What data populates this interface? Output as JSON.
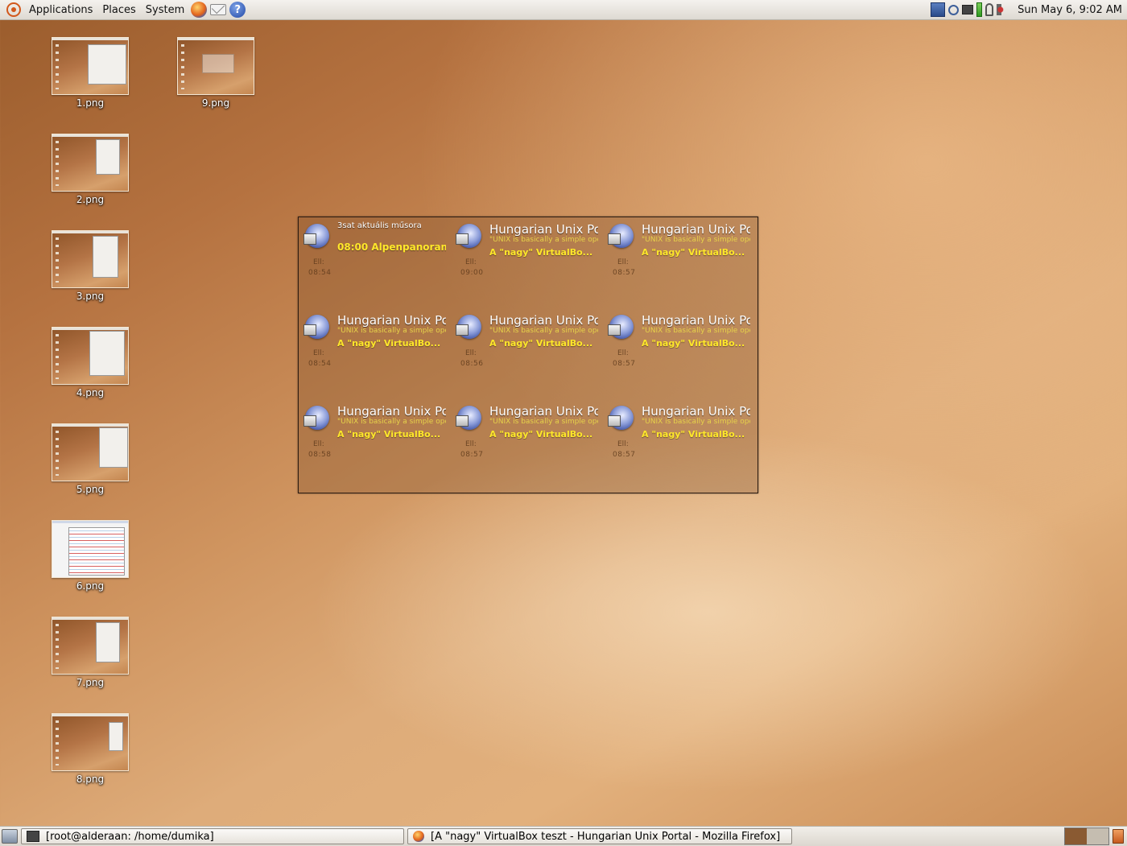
{
  "top_panel": {
    "menus": [
      "Applications",
      "Places",
      "System"
    ],
    "clock": "Sun May  6,  9:02 AM"
  },
  "desktop_icons": [
    {
      "label": "1.png"
    },
    {
      "label": "9.png"
    },
    {
      "label": "2.png"
    },
    {
      "label": "3.png"
    },
    {
      "label": "4.png"
    },
    {
      "label": "5.png"
    },
    {
      "label": "6.png"
    },
    {
      "label": "7.png"
    },
    {
      "label": "8.png"
    }
  ],
  "feed": {
    "ell_label": "Ell:",
    "items": [
      {
        "title": "3sat aktuális műsora",
        "subtitle": "",
        "headline": "08:00 Alpenpanoram...",
        "time": "08:54"
      },
      {
        "title": "Hungarian Unix Portal",
        "subtitle": "\"UNIX is basically a simple operating system\"",
        "headline": "A \"nagy\" VirtualBo...",
        "time": "09:00"
      },
      {
        "title": "Hungarian Unix Portal",
        "subtitle": "\"UNIX is basically a simple operating system\"",
        "headline": "A \"nagy\" VirtualBo...",
        "time": "08:57"
      },
      {
        "title": "Hungarian Unix Portal",
        "subtitle": "\"UNIX is basically a simple operating system\"",
        "headline": "A \"nagy\" VirtualBo...",
        "time": "08:54"
      },
      {
        "title": "Hungarian Unix Portal",
        "subtitle": "\"UNIX is basically a simple operating system\"",
        "headline": "A \"nagy\" VirtualBo...",
        "time": "08:56"
      },
      {
        "title": "Hungarian Unix Portal",
        "subtitle": "\"UNIX is basically a simple operating system\"",
        "headline": "A \"nagy\" VirtualBo...",
        "time": "08:57"
      },
      {
        "title": "Hungarian Unix Portal",
        "subtitle": "\"UNIX is basically a simple operating system\"",
        "headline": "A \"nagy\" VirtualBo...",
        "time": "08:58"
      },
      {
        "title": "Hungarian Unix Portal",
        "subtitle": "\"UNIX is basically a simple operating system\"",
        "headline": "A \"nagy\" VirtualBo...",
        "time": "08:57"
      },
      {
        "title": "Hungarian Unix Portal",
        "subtitle": "\"UNIX is basically a simple operating system\"",
        "headline": "A \"nagy\" VirtualBo...",
        "time": "08:57"
      }
    ]
  },
  "taskbar": {
    "tasks": [
      {
        "label": "[root@alderaan: /home/dumika]"
      },
      {
        "label": "[A \"nagy\" VirtualBox teszt - Hungarian Unix Portal - Mozilla Firefox]"
      }
    ]
  },
  "icons": {
    "menu_logo": "ubuntu-logo-icon",
    "launchers": [
      "firefox-icon",
      "mail-icon",
      "help-icon"
    ],
    "tray": [
      "network-icon",
      "search-icon",
      "monitor-icon",
      "battery-icon",
      "power-icon",
      "volume-icon"
    ],
    "feed_item": "feed-globe-icon",
    "taskbar": [
      "show-desktop-icon",
      "terminal-icon",
      "firefox-icon",
      "trash-icon"
    ]
  },
  "colors": {
    "panel": "#e8e4dc",
    "headline": "#ffe82a",
    "workspace_active": "#8a5a32"
  }
}
